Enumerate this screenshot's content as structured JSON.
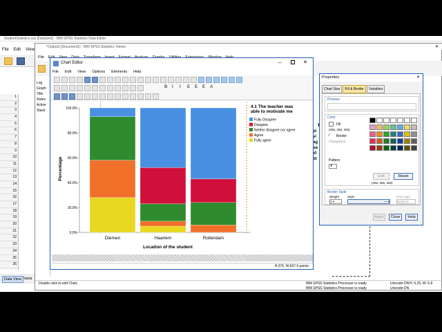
{
  "spss_data_editor": {
    "title": "StudentStatistics.sav [DataSet1] - IBM SPSS Statistics Data Editor",
    "menu": [
      "File",
      "Edit",
      "View"
    ],
    "row_numbers": [
      "1",
      "2",
      "3",
      "4",
      "5",
      "6",
      "7",
      "8",
      "9",
      "10",
      "11",
      "12",
      "13",
      "14",
      "15",
      "16",
      "17",
      "18",
      "19",
      "20",
      "21",
      "22",
      "23",
      "24",
      "25",
      "26"
    ],
    "tab_data_view": "Data View",
    "tab_variable_view": "Varia"
  },
  "spss_viewer": {
    "title": "*Output1 [Document1] - IBM SPSS Statistics Viewer",
    "menu": [
      "File",
      "Edit",
      "View",
      "Data",
      "Transform",
      "Insert",
      "Format",
      "Analyze",
      "Graphs",
      "Utilities",
      "Extensions",
      "Window",
      "Help"
    ],
    "tree": [
      "Log",
      "Graph",
      "Title",
      "Notes",
      "Active",
      "Stack"
    ],
    "status_left": "Double click to edit Chart",
    "status_proc": "IBM SPSS Statistics Processor is ready",
    "status_unicode": "Unicode:ON",
    "status_dims": "H: 5.25, W: 6.9",
    "bottom_proc": "IBM SPSS Statistics Processor is ready",
    "bottom_unicode": "Unicode:ON",
    "side_text": "Th\npi\nvi\nag\npa\nVi\nbt"
  },
  "chart_editor": {
    "title": "Chart Editor",
    "menu": [
      "File",
      "Edit",
      "View",
      "Options",
      "Elements",
      "Help"
    ],
    "status": "H:375, W:637.5 points",
    "format_buttons": [
      "B",
      "I",
      "I",
      "E",
      "E",
      "E",
      "A"
    ]
  },
  "colors": {
    "fully_disagree": "#4a90e2",
    "disagree": "#d0103a",
    "neither": "#2e8b2e",
    "agree": "#f0702a",
    "fully_agree": "#e8d820"
  },
  "chart_data": {
    "type": "bar",
    "stacked": true,
    "categories": [
      "Diemen",
      "Haarlem",
      "Rotterdam"
    ],
    "xlabel": "Location of the student",
    "ylabel": "Percentage",
    "ylim": [
      0,
      100
    ],
    "yticks": [
      "0.0%",
      "20.0%",
      "40.0%",
      "60.0%",
      "80.0%",
      "100.0%"
    ],
    "legend_title": "4.1 The teacher was able to motivate me",
    "legend_placement": "right",
    "series": [
      {
        "name": "Fully Disagree",
        "color": "#4a90e2",
        "values": [
          7,
          48,
          57
        ]
      },
      {
        "name": "Disagree",
        "color": "#d0103a",
        "values": [
          0,
          29,
          19
        ]
      },
      {
        "name": "Neither disagree nor agree",
        "color": "#2e8b2e",
        "values": [
          35,
          14,
          18
        ]
      },
      {
        "name": "Agree",
        "color": "#f0702a",
        "values": [
          30,
          4,
          6
        ]
      },
      {
        "name": "Fully agree",
        "color": "#e8d820",
        "values": [
          28,
          5,
          0
        ]
      }
    ]
  },
  "properties": {
    "title": "Properties",
    "tabs": [
      "Chart Size",
      "Fill & Border",
      "Variables"
    ],
    "preview_label": "Preview",
    "color_label": "Color",
    "fill_label": "Fill",
    "fill_value": "(255, 255, 255)",
    "border_label": "Border",
    "border_value": "Transparent",
    "pattern_label": "Pattern",
    "edit_label": "Edit",
    "reset_label": "Reset",
    "swatch_value": "(255, 255, 255)",
    "border_style_label": "Border Style",
    "weight_label": "Weight",
    "weight_value": "1",
    "style_label": "Style",
    "end_caps_label": "End Caps",
    "end_caps_value": "Butted",
    "apply_label": "Apply",
    "close_label": "Close",
    "help_label": "Help",
    "palette": [
      "#000000",
      "#ffffff",
      "#ffffff",
      "#ffffff",
      "#ffffff",
      "#ffffff",
      "#ffffff",
      "#e8a0c8",
      "#f0c060",
      "#a0d060",
      "#60c0a0",
      "#60b0e0",
      "#f0e060",
      "#c0c0c0",
      "#f06080",
      "#e89020",
      "#30a030",
      "#208080",
      "#3070c0",
      "#e0c000",
      "#909090",
      "#e03060",
      "#d06010",
      "#208020",
      "#106060",
      "#1040a0",
      "#a08000",
      "#606060",
      "#b01030",
      "#904010",
      "#106010",
      "#004040",
      "#002060",
      "#605000",
      "#404040"
    ]
  }
}
